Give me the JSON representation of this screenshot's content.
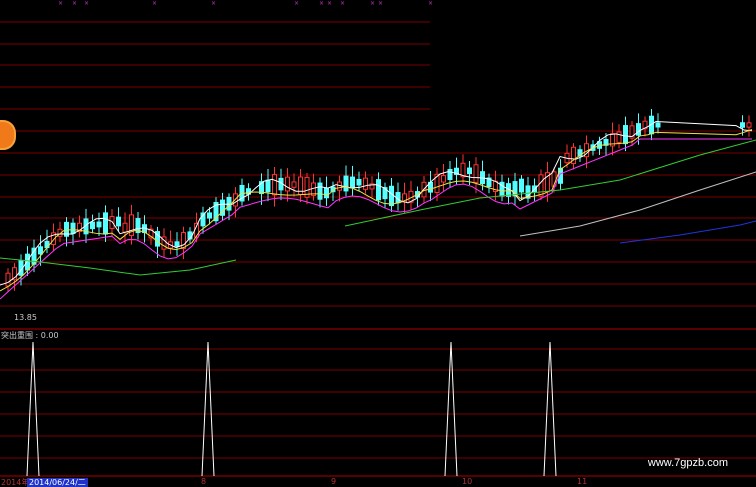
{
  "main_chart": {
    "low_price_label": "13.85",
    "colors": {
      "bg": "#000000",
      "grid": "#7a0000",
      "candle_up": "#ff3333",
      "candle_down": "#55ffff",
      "ma5": "#ffffff",
      "ma10": "#f0e040",
      "ma20": "#ff33ff",
      "ma60": "#33cc33",
      "ma120": "#c0c0c0",
      "ma250": "#2233dd"
    }
  },
  "indicator": {
    "title": "突出重围 : 0.00",
    "spike_color": "#ffffff"
  },
  "time_axis": {
    "year_label": "2014年",
    "selected_date": "2014/06/24/二",
    "month_ticks": [
      "8",
      "9",
      "10",
      "11"
    ]
  },
  "badge_icon": "orange-circle-icon",
  "watermark": "www.7gpzb.com"
}
